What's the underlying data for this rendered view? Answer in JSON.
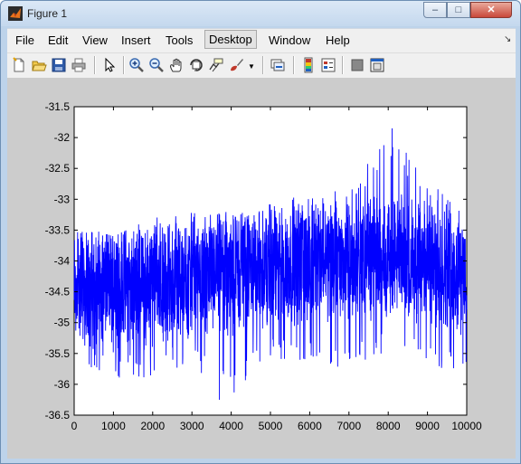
{
  "window": {
    "title": "Figure 1"
  },
  "window_controls": {
    "minimize": "–",
    "maximize": "□",
    "close": "✕"
  },
  "menu": [
    {
      "label": "File"
    },
    {
      "label": "Edit"
    },
    {
      "label": "View"
    },
    {
      "label": "Insert"
    },
    {
      "label": "Tools"
    },
    {
      "label": "Desktop"
    },
    {
      "label": "Window"
    },
    {
      "label": "Help"
    }
  ],
  "toolbar_icons": [
    "new-figure-icon",
    "open-file-icon",
    "save-icon",
    "print-icon",
    "edit-plot-arrow-icon",
    "zoom-in-icon",
    "zoom-out-icon",
    "pan-hand-icon",
    "rotate-3d-icon",
    "data-cursor-icon",
    "brush-icon",
    "brush-dropdown-icon",
    "link-plot-icon",
    "insert-colorbar-icon",
    "insert-legend-icon",
    "hide-plot-tools-icon",
    "show-plot-tools-icon"
  ],
  "colors": {
    "line": "#0000ff",
    "figure_bg": "#cccccc",
    "axes_bg": "#ffffff"
  },
  "chart_data": {
    "type": "line",
    "title": "",
    "xlabel": "",
    "ylabel": "",
    "xlim": [
      0,
      10000
    ],
    "ylim": [
      -36.5,
      -31.5
    ],
    "xticks": [
      0,
      1000,
      2000,
      3000,
      4000,
      5000,
      6000,
      7000,
      8000,
      9000,
      10000
    ],
    "yticks": [
      -31.5,
      -32,
      -32.5,
      -33,
      -33.5,
      -34,
      -34.5,
      -35,
      -35.5,
      -36,
      -36.5
    ],
    "grid": false,
    "n_points": 10000,
    "trend": {
      "x": [
        0,
        2000,
        4000,
        6000,
        8000,
        10000
      ],
      "mean": [
        -34.4,
        -34.4,
        -34.2,
        -34.0,
        -33.9,
        -34.2
      ]
    },
    "range_band": {
      "x": [
        0,
        1000,
        2000,
        3000,
        4000,
        5000,
        6000,
        7000,
        8000,
        9000,
        10000
      ],
      "min": [
        -35.7,
        -35.9,
        -35.9,
        -35.7,
        -36.2,
        -35.6,
        -35.7,
        -35.8,
        -35.5,
        -35.7,
        -35.9
      ],
      "max": [
        -33.4,
        -33.6,
        -33.3,
        -33.2,
        -33.1,
        -32.9,
        -33.0,
        -32.8,
        -31.9,
        -32.6,
        -33.3
      ]
    },
    "extremes": [
      {
        "x": 8100,
        "y": -31.85,
        "label": "max"
      },
      {
        "x": 3700,
        "y": -36.25,
        "label": "min"
      }
    ]
  }
}
